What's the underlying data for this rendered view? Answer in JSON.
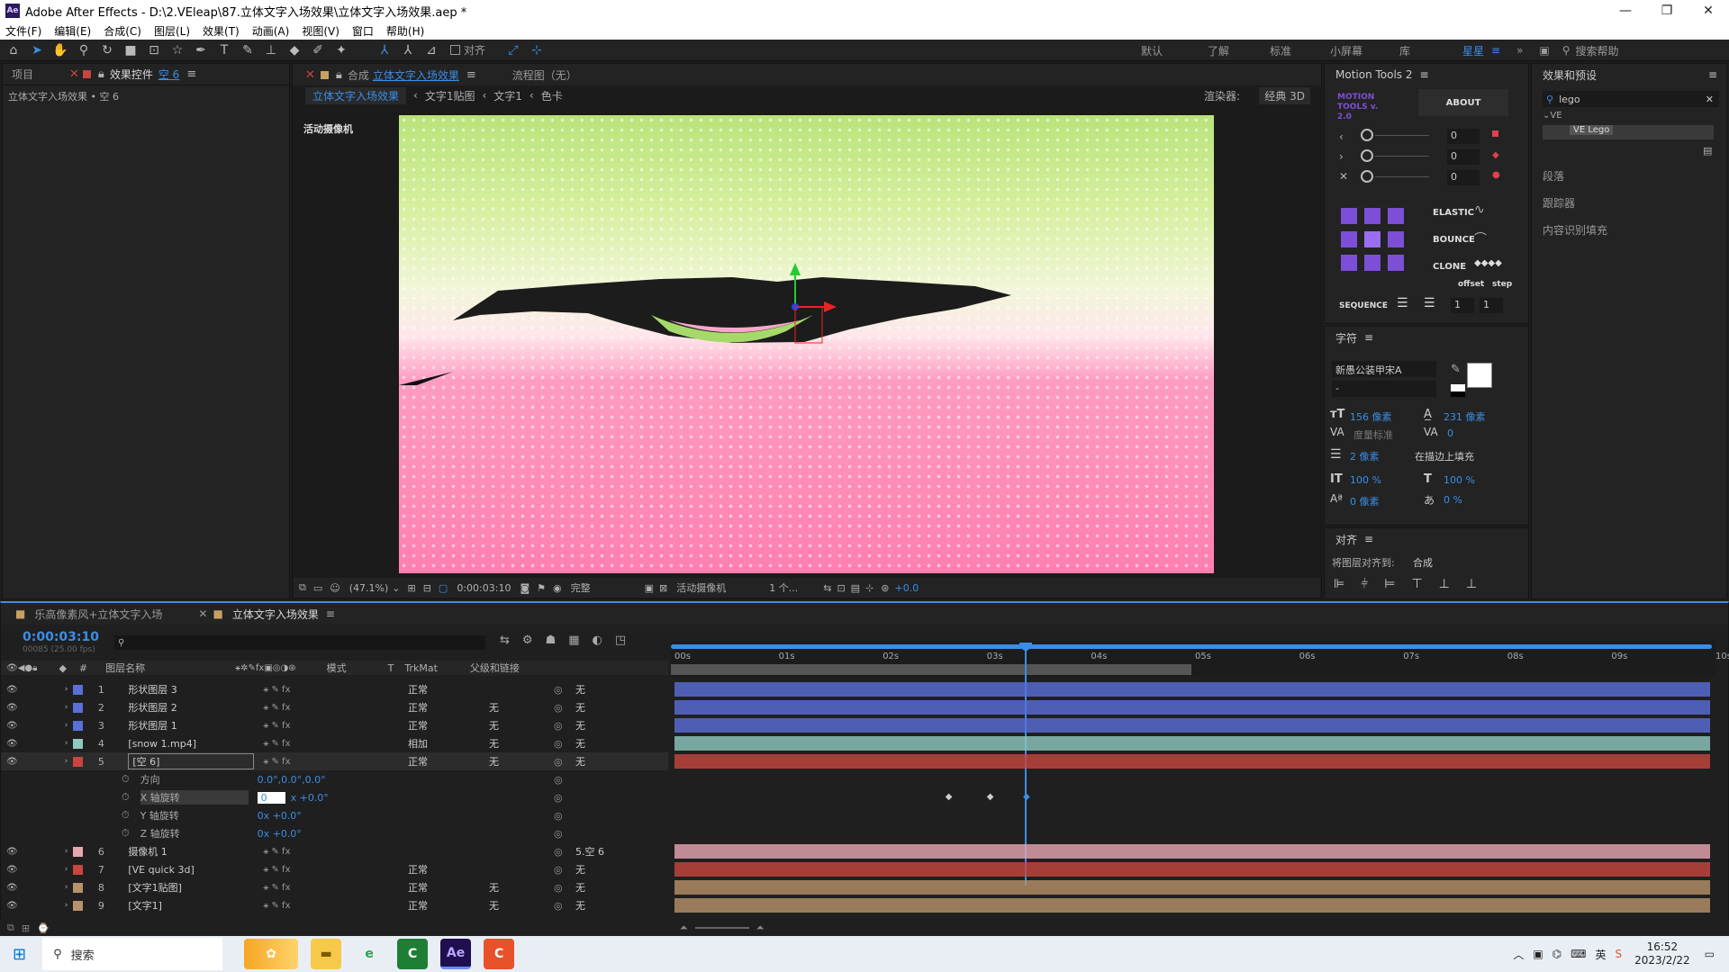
{
  "window": {
    "title": "Adobe After Effects - D:\\2.VEleap\\87.立体文字入场效果\\立体文字入场效果.aep *",
    "logo": "Ae"
  },
  "menu": [
    "文件(F)",
    "编辑(E)",
    "合成(C)",
    "图层(L)",
    "效果(T)",
    "动画(A)",
    "视图(V)",
    "窗口",
    "帮助(H)"
  ],
  "toolbar": {
    "align_label": "对齐"
  },
  "workspaces": [
    "默认",
    "了解",
    "标准",
    "小屏幕",
    "库",
    "星星"
  ],
  "search_help": "搜索帮助",
  "project_panel": {
    "tab_project": "项目",
    "tab_effects": "效果控件",
    "effects_target": "空 6",
    "breadcrumb": "立体文字入场效果 • 空 6"
  },
  "comp_panel": {
    "tab_prefix": "合成",
    "tab_name": "立体文字入场效果",
    "tab_flow": "流程图（无）",
    "crumbs": [
      "立体文字入场效果",
      "文字1贴图",
      "文字1",
      "色卡"
    ],
    "renderer_label": "渲染器:",
    "renderer": "经典 3D",
    "camera_label": "活动摄像机",
    "zoom": "(47.1%)",
    "timecode": "0:00:03:10",
    "quality": "完整",
    "view_camera": "活动摄像机",
    "view_count": "1 个...",
    "offset": "+0.0"
  },
  "motion_tools": {
    "title": "Motion Tools 2",
    "logo": "MOTION TOOLS v. 2.0",
    "about": "ABOUT",
    "sliders": [
      "0",
      "0",
      "0"
    ],
    "elastic": "ELASTIC",
    "bounce": "BOUNCE",
    "clone": "CLONE",
    "offset": "offset",
    "step": "step",
    "sequence": "SEQUENCE",
    "seq_values": [
      "1",
      "1"
    ]
  },
  "effects_presets": {
    "title": "效果和预设",
    "search": "lego",
    "folder": "VE",
    "item": "VE Lego",
    "sections": [
      "段落",
      "跟踪器",
      "内容识别填充"
    ]
  },
  "character": {
    "title": "字符",
    "font": "新愚公装甲宋A",
    "style": "-",
    "size": "156 像素",
    "leading": "231 像素",
    "kerning": "度量标准",
    "tracking": "0",
    "stroke": "2 像素",
    "stroke_mode": "在描边上填充",
    "vscale": "100 %",
    "hscale": "100 %",
    "baseline": "0 像素",
    "tsume": "0 %"
  },
  "align": {
    "title": "对齐",
    "label": "将图层对齐到:",
    "target": "合成"
  },
  "timeline": {
    "tabs": [
      "乐高像素风+立体文字入场",
      "立体文字入场效果"
    ],
    "timecode": "0:00:03:10",
    "frames": "00085 (25.00 fps)",
    "col_name": "图层名称",
    "col_mode": "模式",
    "col_t": "T",
    "col_trkmat": "TrkMat",
    "col_parent": "父级和链接",
    "ruler": [
      "00s",
      "01s",
      "02s",
      "03s",
      "04s",
      "05s",
      "06s",
      "07s",
      "08s",
      "09s",
      "10s"
    ],
    "layers": [
      {
        "num": "1",
        "name": "形状图层 3",
        "mode": "正常",
        "trk": "",
        "parent": "无",
        "color": "#5a6fd8"
      },
      {
        "num": "2",
        "name": "形状图层 2",
        "mode": "正常",
        "trk": "无",
        "parent": "无",
        "color": "#5a6fd8"
      },
      {
        "num": "3",
        "name": "形状图层 1",
        "mode": "正常",
        "trk": "无",
        "parent": "无",
        "color": "#5a6fd8"
      },
      {
        "num": "4",
        "name": "[snow 1.mp4]",
        "mode": "相加",
        "trk": "无",
        "parent": "无",
        "color": "#8fc9c1"
      },
      {
        "num": "5",
        "name": "[空 6]",
        "mode": "正常",
        "trk": "无",
        "parent": "无",
        "color": "#c8463e"
      }
    ],
    "props": [
      {
        "name": "方向",
        "value": "0.0°,0.0°,0.0°"
      },
      {
        "name": "X 轴旋转",
        "value": "0",
        "value2": "x +0.0°"
      },
      {
        "name": "Y 轴旋转",
        "value": "0x +0.0°"
      },
      {
        "name": "Z 轴旋转",
        "value": "0x +0.0°"
      }
    ],
    "layers2": [
      {
        "num": "6",
        "name": "摄像机 1",
        "mode": "",
        "trk": "",
        "parent": "5.空 6",
        "color": "#e8a6b2"
      },
      {
        "num": "7",
        "name": "[VE quick 3d]",
        "mode": "正常",
        "trk": "",
        "parent": "无",
        "color": "#c8463e"
      },
      {
        "num": "8",
        "name": "[文字1贴图]",
        "mode": "正常",
        "trk": "无",
        "parent": "无",
        "color": "#b8926a"
      },
      {
        "num": "9",
        "name": "[文字1]",
        "mode": "正常",
        "trk": "无",
        "parent": "无",
        "color": "#b8926a"
      }
    ],
    "playhead": 3.4,
    "work_end": 5.0,
    "duration": 10
  },
  "taskbar": {
    "search": "搜索",
    "time": "16:52",
    "date": "2023/2/22",
    "ime": "英"
  }
}
